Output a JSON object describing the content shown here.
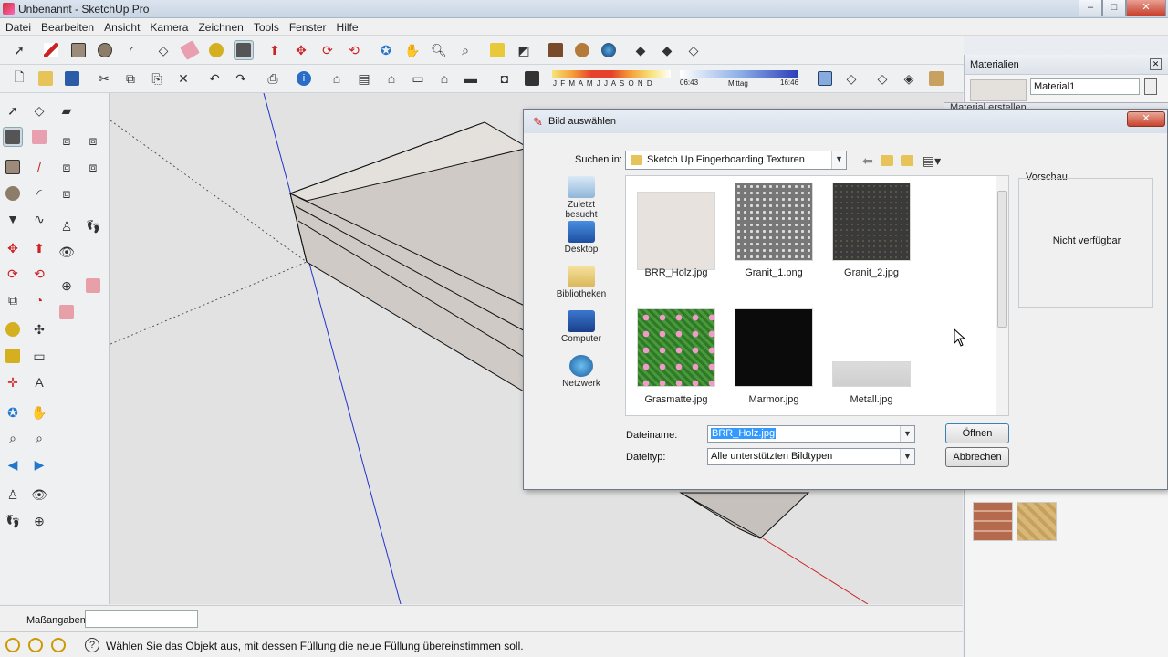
{
  "window": {
    "title": "Unbenannt - SketchUp Pro",
    "controls": [
      "–",
      "□",
      "✕"
    ]
  },
  "menu": [
    "Datei",
    "Bearbeiten",
    "Ansicht",
    "Kamera",
    "Zeichnen",
    "Tools",
    "Fenster",
    "Hilfe"
  ],
  "shadow_bar": {
    "months": "J F M A M J J A S O N D",
    "time_start": "06:43",
    "time_mid": "Mittag",
    "time_end": "16:46"
  },
  "statusbar": {
    "measure_label": "Maßangaben",
    "measure_value": "",
    "hint": "Wählen Sie das Objekt aus, mit dessen Füllung die neue Füllung übereinstimmen soll."
  },
  "materials": {
    "panel_title": "Materialien",
    "material_name": "Material1",
    "behind_title": "Material erstellen"
  },
  "dialog": {
    "title": "Bild auswählen",
    "lookin_label": "Suchen in:",
    "lookin_value": "Sketch Up Fingerboarding Texturen",
    "places": [
      "Zuletzt besucht",
      "Desktop",
      "Bibliotheken",
      "Computer",
      "Netzwerk"
    ],
    "files": [
      "BRR_Holz.jpg",
      "Granit_1.png",
      "Granit_2.jpg",
      "Grasmatte.jpg",
      "Marmor.jpg",
      "Metall.jpg"
    ],
    "preview_label": "Vorschau",
    "preview_text": "Nicht verfügbar",
    "filename_label": "Dateiname:",
    "filename_value": "BRR_Holz.jpg",
    "filetype_label": "Dateityp:",
    "filetype_value": "Alle unterstützten Bildtypen",
    "open_button": "Öffnen",
    "cancel_button": "Abbrechen"
  },
  "colors": {
    "accent": "#3399ff",
    "axis_blue": "#2233cc",
    "axis_red": "#cc2222",
    "axis_green": "#22aa22"
  }
}
